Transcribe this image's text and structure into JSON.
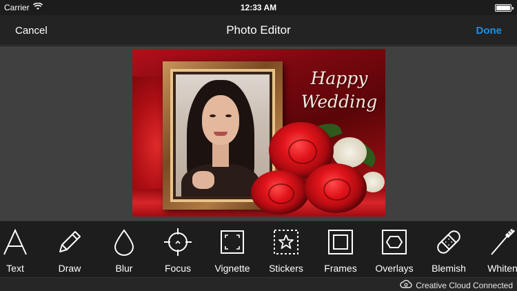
{
  "status_bar": {
    "carrier": "Carrier",
    "time": "12:33 AM"
  },
  "nav": {
    "cancel_label": "Cancel",
    "title": "Photo Editor",
    "done_label": "Done"
  },
  "colors": {
    "accent": "#1e8fe1",
    "toolbar_bg": "#1d1d1d",
    "canvas_bg": "#404040"
  },
  "photo": {
    "text_line1": "Happy",
    "text_line2": "Wedding"
  },
  "tools": [
    {
      "label": "Text",
      "icon": "text-icon"
    },
    {
      "label": "Draw",
      "icon": "pencil-icon"
    },
    {
      "label": "Blur",
      "icon": "droplet-icon"
    },
    {
      "label": "Focus",
      "icon": "crosshair-icon"
    },
    {
      "label": "Vignette",
      "icon": "vignette-icon"
    },
    {
      "label": "Stickers",
      "icon": "star-sticker-icon"
    },
    {
      "label": "Frames",
      "icon": "frame-icon"
    },
    {
      "label": "Overlays",
      "icon": "hexagon-icon"
    },
    {
      "label": "Blemish",
      "icon": "bandage-icon"
    },
    {
      "label": "Whiten",
      "icon": "toothbrush-icon"
    }
  ],
  "footer": {
    "cc_label": "Creative Cloud Connected"
  }
}
